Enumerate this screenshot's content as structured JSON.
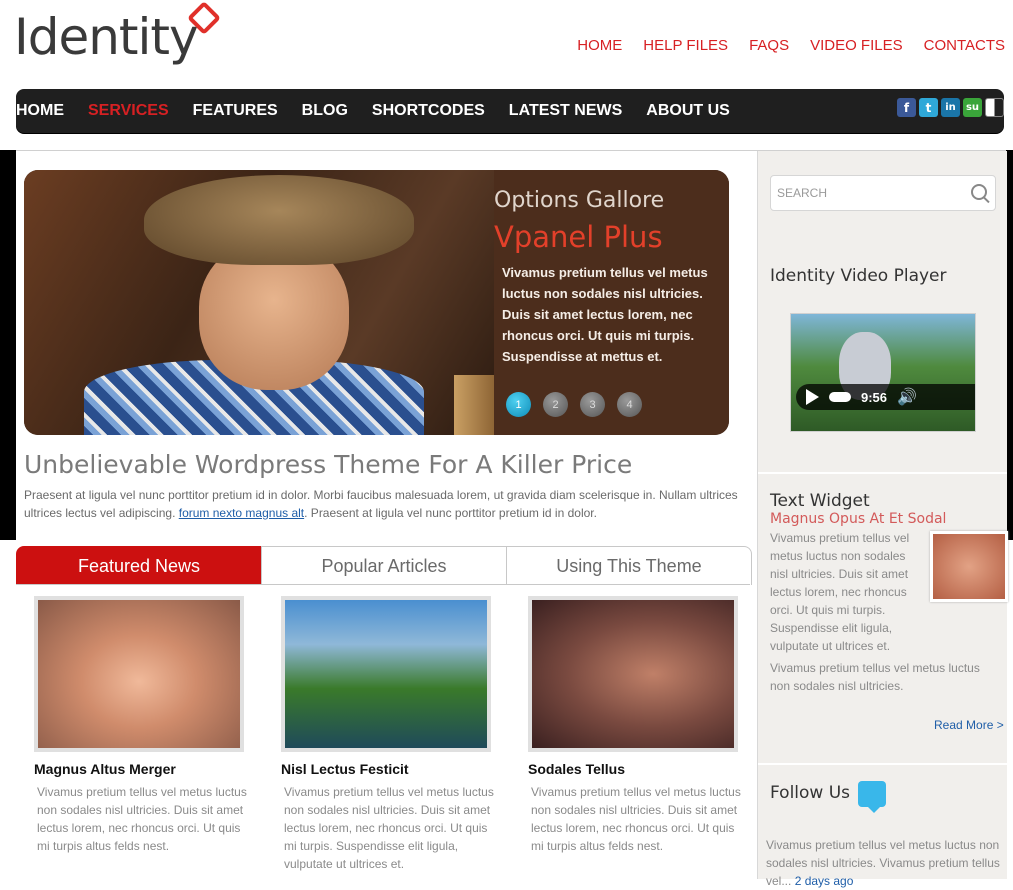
{
  "brand": {
    "logo_text": "Identity"
  },
  "top_nav": [
    "HOME",
    "HELP FILES",
    "FAQS",
    "VIDEO FILES",
    "CONTACTS"
  ],
  "main_nav": [
    "HOME",
    "SERVICES",
    "FEATURES",
    "BLOG",
    "SHORTCODES",
    "LATEST NEWS",
    "ABOUT US"
  ],
  "main_nav_active": "SERVICES",
  "social": [
    {
      "name": "facebook-icon",
      "glyph": "f",
      "color": "#3b5998"
    },
    {
      "name": "twitter-icon",
      "glyph": "t",
      "color": "#2fa8d8"
    },
    {
      "name": "linkedin-icon",
      "glyph": "in",
      "color": "#1a75a8"
    },
    {
      "name": "stumbleupon-icon",
      "glyph": "su",
      "color": "#3aa53a"
    },
    {
      "name": "delicious-icon",
      "glyph": "",
      "color": "#222222"
    }
  ],
  "slider": {
    "kicker": "Options Gallore",
    "title": "Vpanel Plus",
    "text": "Vivamus pretium tellus vel metus luctus non sodales nisl ultricies. Duis sit amet lectus lorem, nec rhoncus orci. Ut quis mi turpis. Suspendisse at mettus et.",
    "dots": [
      "1",
      "2",
      "3",
      "4"
    ],
    "active_dot": "1"
  },
  "intro": {
    "headline": "Unbelievable Wordpress Theme For A Killer Price",
    "text_before": "Praesent at ligula vel nunc porttitor pretium id in dolor. Morbi faucibus malesuada lorem, ut gravida diam scelerisque in. Nullam ultrices ultrices lectus vel adipiscing. ",
    "link": "forum nexto magnus alt",
    "text_after": ". Praesent at ligula vel nunc porttitor pretium id in dolor."
  },
  "tabs": [
    "Featured News",
    "Popular Articles",
    "Using This Theme"
  ],
  "articles": [
    {
      "title": "Magnus Altus Merger",
      "text": "Vivamus pretium tellus vel metus luctus non sodales nisl ultricies. Duis sit amet lectus lorem, nec rhoncus orci. Ut quis mi turpis altus felds nest."
    },
    {
      "title": "Nisl Lectus Festicit",
      "text": "Vivamus pretium tellus vel metus luctus non sodales nisl ultricies. Duis sit amet lectus lorem, nec rhoncus orci. Ut quis mi turpis. Suspendisse elit ligula, vulputate ut ultrices et."
    },
    {
      "title": "Sodales Tellus",
      "text": "Vivamus pretium tellus vel metus luctus non sodales nisl ultricies. Duis sit amet lectus lorem, nec rhoncus orci. Ut quis mi turpis altus felds nest."
    }
  ],
  "sidebar": {
    "search_placeholder": "SEARCH",
    "video_heading": "Identity Video Player",
    "video_time": "9:56",
    "text_widget_heading": "Text Widget",
    "text_widget_subheading": "Magnus Opus At Et Sodal",
    "text_widget_body": "Vivamus pretium tellus vel metus luctus non sodales nisl ultricies. Duis sit amet lectus lorem, nec rhoncus orci. Ut quis mi turpis. Suspendisse elit ligula, vulputate ut ultrices et.",
    "text_widget_body2": "Vivamus pretium tellus vel metus luctus non sodales nisl ultricies.",
    "read_more": "Read More >",
    "follow_heading": "Follow Us",
    "follow_text": "Vivamus pretium tellus vel metus luctus non sodales nisl ultricies. Vivamus pretium tellus vel...",
    "follow_time": "2 days ago"
  },
  "colors": {
    "accent": "#cc1010",
    "nav_bg": "#1f1f1f",
    "link": "#1f5ea8"
  }
}
